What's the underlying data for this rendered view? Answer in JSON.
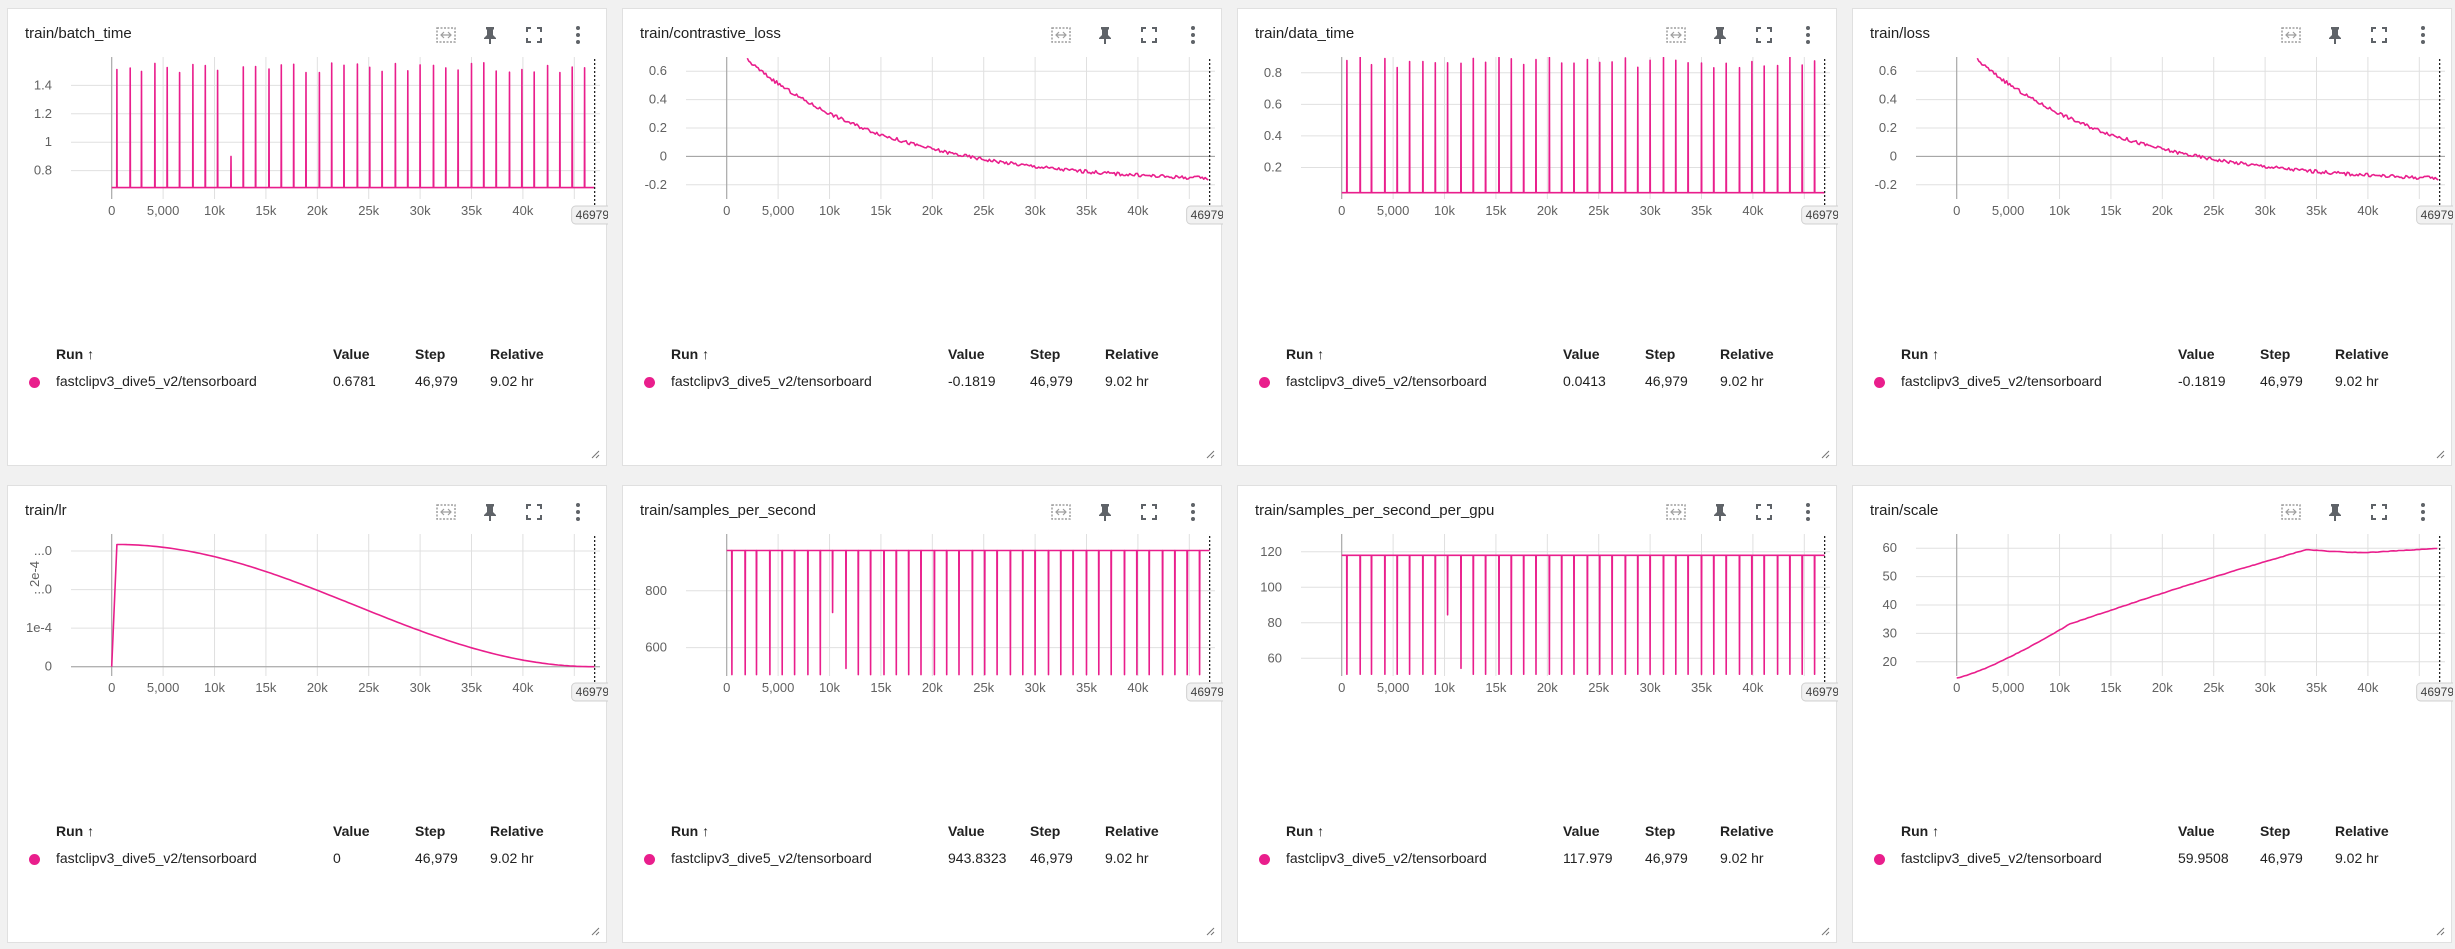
{
  "accent_color": "#e91e8c",
  "table_headers": {
    "run": "Run ↑",
    "value": "Value",
    "step": "Step",
    "relative": "Relative"
  },
  "icons": [
    "fit-domain-icon",
    "pin-icon",
    "fullscreen-icon",
    "more-vert-icon"
  ],
  "cards": [
    {
      "title": "train/batch_time",
      "run": "fastclipv3_dive5_v2/tensorboard",
      "value": "0.6781",
      "step": "46,979",
      "relative": "9.02 hr",
      "step_badge": "46979",
      "chart_data": {
        "type": "line",
        "x_ticks": [
          "0",
          "5,000",
          "10k",
          "15k",
          "20k",
          "25k",
          "30k",
          "35k",
          "40k"
        ],
        "y_ticks": [
          {
            "label": "0.8",
            "v": 0.8
          },
          {
            "label": "1",
            "v": 1.0
          },
          {
            "label": "1.2",
            "v": 1.2
          },
          {
            "label": "1.4",
            "v": 1.4
          }
        ],
        "ylim": [
          0.6,
          1.6
        ],
        "xlim": [
          0,
          47000
        ],
        "pattern": "spikes",
        "baseline": 0.68,
        "spike_top": 1.56,
        "spike_steps": [
          500,
          1800,
          2900,
          4200,
          5400,
          6600,
          7900,
          9100,
          10300,
          11600,
          12800,
          14000,
          15300,
          16500,
          17700,
          18900,
          20200,
          21400,
          22600,
          23900,
          25100,
          26300,
          27600,
          28800,
          30000,
          31300,
          32500,
          33700,
          35000,
          36200,
          37400,
          38700,
          39900,
          41100,
          42400,
          43600,
          44800,
          46000
        ],
        "last_step": 46979
      }
    },
    {
      "title": "train/contrastive_loss",
      "run": "fastclipv3_dive5_v2/tensorboard",
      "value": "-0.1819",
      "step": "46,979",
      "relative": "9.02 hr",
      "step_badge": "46979",
      "chart_data": {
        "type": "line",
        "x_ticks": [
          "0",
          "5,000",
          "10k",
          "15k",
          "20k",
          "25k",
          "30k",
          "35k",
          "40k"
        ],
        "y_ticks": [
          {
            "label": "-0.2",
            "v": -0.2
          },
          {
            "label": "0",
            "v": 0
          },
          {
            "label": "0.2",
            "v": 0.2
          },
          {
            "label": "0.4",
            "v": 0.4
          },
          {
            "label": "0.6",
            "v": 0.6
          }
        ],
        "ylim": [
          -0.3,
          0.7
        ],
        "xlim": [
          0,
          47000
        ],
        "pattern": "decay",
        "start": 0.68,
        "end": -0.19,
        "last_step": 46979
      }
    },
    {
      "title": "train/data_time",
      "run": "fastclipv3_dive5_v2/tensorboard",
      "value": "0.0413",
      "step": "46,979",
      "relative": "9.02 hr",
      "step_badge": "46979",
      "chart_data": {
        "type": "line",
        "x_ticks": [
          "0",
          "5,000",
          "10k",
          "15k",
          "20k",
          "25k",
          "30k",
          "35k",
          "40k"
        ],
        "y_ticks": [
          {
            "label": "0.2",
            "v": 0.2
          },
          {
            "label": "0.4",
            "v": 0.4
          },
          {
            "label": "0.6",
            "v": 0.6
          },
          {
            "label": "0.8",
            "v": 0.8
          }
        ],
        "ylim": [
          0,
          0.9
        ],
        "xlim": [
          0,
          47000
        ],
        "pattern": "spikes",
        "baseline": 0.04,
        "spike_top": 0.9,
        "spike_steps": [
          500,
          1800,
          2900,
          4200,
          5400,
          6600,
          7900,
          9100,
          10300,
          11600,
          12800,
          14000,
          15300,
          16500,
          17700,
          18900,
          20200,
          21400,
          22600,
          23900,
          25100,
          26300,
          27600,
          28800,
          30000,
          31300,
          32500,
          33700,
          35000,
          36200,
          37400,
          38700,
          39900,
          41100,
          42400,
          43600,
          44800,
          46000
        ],
        "last_step": 46979
      }
    },
    {
      "title": "train/loss",
      "run": "fastclipv3_dive5_v2/tensorboard",
      "value": "-0.1819",
      "step": "46,979",
      "relative": "9.02 hr",
      "step_badge": "46979",
      "chart_data": {
        "type": "line",
        "x_ticks": [
          "0",
          "5,000",
          "10k",
          "15k",
          "20k",
          "25k",
          "30k",
          "35k",
          "40k"
        ],
        "y_ticks": [
          {
            "label": "-0.2",
            "v": -0.2
          },
          {
            "label": "0",
            "v": 0
          },
          {
            "label": "0.2",
            "v": 0.2
          },
          {
            "label": "0.4",
            "v": 0.4
          },
          {
            "label": "0.6",
            "v": 0.6
          }
        ],
        "ylim": [
          -0.3,
          0.7
        ],
        "xlim": [
          0,
          47000
        ],
        "pattern": "decay",
        "start": 0.68,
        "end": -0.19,
        "last_step": 46979
      }
    },
    {
      "title": "train/lr",
      "run": "fastclipv3_dive5_v2/tensorboard",
      "value": "0",
      "step": "46,979",
      "relative": "9.02 hr",
      "step_badge": "46979",
      "chart_data": {
        "type": "line",
        "x_ticks": [
          "0",
          "5,000",
          "10k",
          "15k",
          "20k",
          "25k",
          "30k",
          "35k",
          "40k"
        ],
        "y_ticks": [
          {
            "label": "0",
            "v": 0
          },
          {
            "label": "1e-4",
            "v": 6.25e-05
          },
          {
            "label": "...0",
            "v": 0.000125
          },
          {
            "label": "...0",
            "v": 0.0001875
          }
        ],
        "y_axis_label": "2e-4",
        "ylim": [
          -1.5e-05,
          0.000215
        ],
        "xlim": [
          0,
          47000
        ],
        "pattern": "warmup_cosine",
        "peak": 0.000198,
        "warmup": 500,
        "last_step": 46979
      }
    },
    {
      "title": "train/samples_per_second",
      "run": "fastclipv3_dive5_v2/tensorboard",
      "value": "943.8323",
      "step": "46,979",
      "relative": "9.02 hr",
      "step_badge": "46979",
      "chart_data": {
        "type": "line",
        "x_ticks": [
          "0",
          "5,000",
          "10k",
          "15k",
          "20k",
          "25k",
          "30k",
          "35k",
          "40k"
        ],
        "y_ticks": [
          {
            "label": "600",
            "v": 600
          },
          {
            "label": "800",
            "v": 800
          }
        ],
        "ylim": [
          500,
          1000
        ],
        "xlim": [
          0,
          47000
        ],
        "pattern": "dips",
        "baseline": 942,
        "dip_bottom": 505,
        "dip_steps": [
          500,
          1800,
          2900,
          4200,
          5400,
          6600,
          7900,
          9100,
          10300,
          11600,
          12800,
          14000,
          15300,
          16500,
          17700,
          18900,
          20200,
          21400,
          22600,
          23900,
          25100,
          26300,
          27600,
          28800,
          30000,
          31300,
          32500,
          33700,
          35000,
          36200,
          37400,
          38700,
          39900,
          41100,
          42400,
          43600,
          44800,
          46000
        ],
        "last_step": 46979
      }
    },
    {
      "title": "train/samples_per_second_per_gpu",
      "run": "fastclipv3_dive5_v2/tensorboard",
      "value": "117.979",
      "step": "46,979",
      "relative": "9.02 hr",
      "step_badge": "46979",
      "chart_data": {
        "type": "line",
        "x_ticks": [
          "0",
          "5,000",
          "10k",
          "15k",
          "20k",
          "25k",
          "30k",
          "35k",
          "40k"
        ],
        "y_ticks": [
          {
            "label": "60",
            "v": 60
          },
          {
            "label": "80",
            "v": 80
          },
          {
            "label": "100",
            "v": 100
          },
          {
            "label": "120",
            "v": 120
          }
        ],
        "ylim": [
          50,
          130
        ],
        "xlim": [
          0,
          47000
        ],
        "pattern": "dips",
        "baseline": 118,
        "dip_bottom": 51,
        "dip_steps": [
          500,
          1800,
          2900,
          4200,
          5400,
          6600,
          7900,
          9100,
          10300,
          11600,
          12800,
          14000,
          15300,
          16500,
          17700,
          18900,
          20200,
          21400,
          22600,
          23900,
          25100,
          26300,
          27600,
          28800,
          30000,
          31300,
          32500,
          33700,
          35000,
          36200,
          37400,
          38700,
          39900,
          41100,
          42400,
          43600,
          44800,
          46000
        ],
        "last_step": 46979
      }
    },
    {
      "title": "train/scale",
      "run": "fastclipv3_dive5_v2/tensorboard",
      "value": "59.9508",
      "step": "46,979",
      "relative": "9.02 hr",
      "step_badge": "46979",
      "chart_data": {
        "type": "line",
        "x_ticks": [
          "0",
          "5,000",
          "10k",
          "15k",
          "20k",
          "25k",
          "30k",
          "35k",
          "40k"
        ],
        "y_ticks": [
          {
            "label": "20",
            "v": 20
          },
          {
            "label": "30",
            "v": 30
          },
          {
            "label": "40",
            "v": 40
          },
          {
            "label": "50",
            "v": 50
          },
          {
            "label": "60",
            "v": 60
          }
        ],
        "ylim": [
          15,
          65
        ],
        "xlim": [
          0,
          47000
        ],
        "pattern": "scale",
        "last_step": 46979
      }
    }
  ]
}
